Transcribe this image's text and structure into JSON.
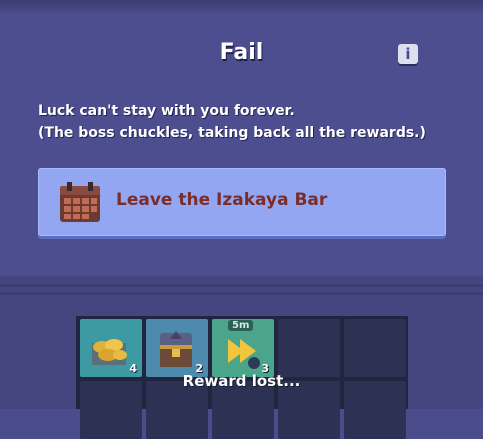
{
  "dialog": {
    "title": "Fail",
    "info_icon": "info-icon",
    "message_line1": "Luck can't stay with you forever.",
    "message_line2": "(The boss chuckles, taking back all the rewards.)"
  },
  "option": {
    "label": "Leave the Izakaya Bar",
    "icon": "calendar-icon"
  },
  "rewards": {
    "items": [
      {
        "icon": "gold-coins-chest-icon",
        "count": "4"
      },
      {
        "icon": "treasure-chest-icon",
        "count": "2"
      },
      {
        "icon": "fast-forward-icon",
        "count": "3",
        "badge": "5m"
      }
    ],
    "status": "Reward lost..."
  },
  "colors": {
    "background": "#4b4c8c",
    "button": "#93a6f2",
    "button_text": "#7a2d2b"
  }
}
